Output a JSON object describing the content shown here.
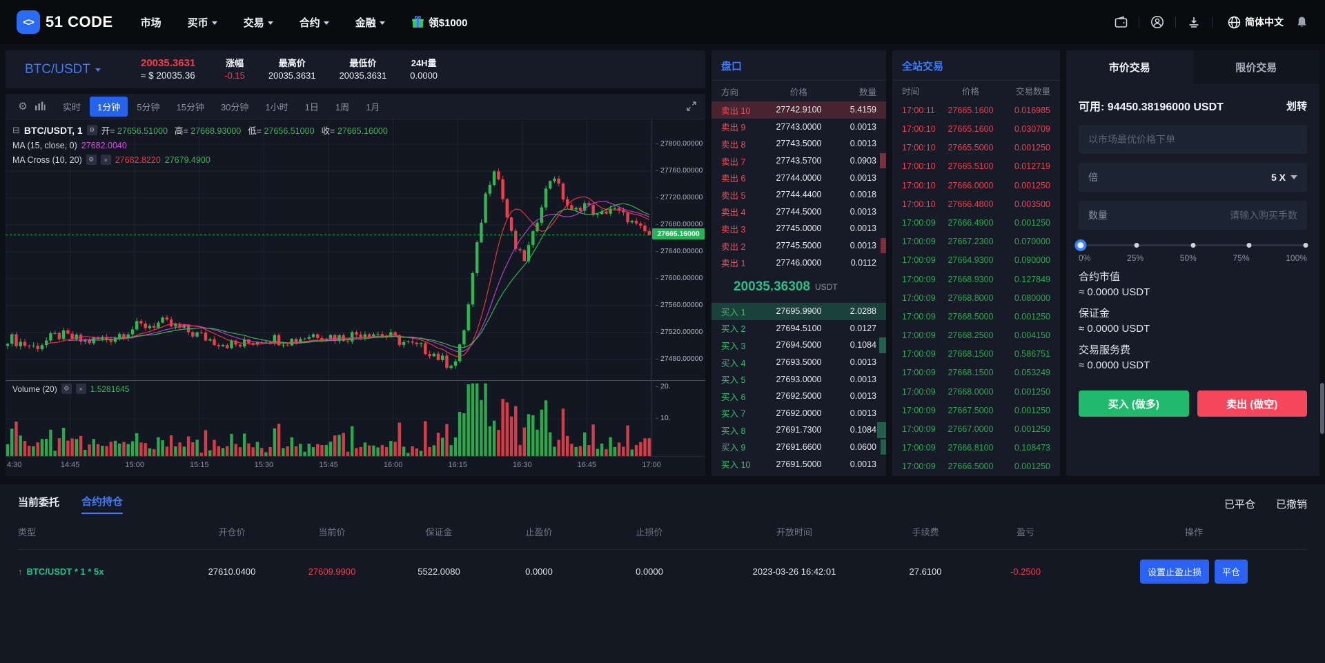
{
  "nav": {
    "brand": "51 CODE",
    "items": [
      {
        "label": "市场",
        "caret": false
      },
      {
        "label": "买币",
        "caret": true
      },
      {
        "label": "交易",
        "caret": true
      },
      {
        "label": "合约",
        "caret": true
      },
      {
        "label": "金融",
        "caret": true
      }
    ],
    "promo": "领$1000",
    "language": "简体中文"
  },
  "ticker": {
    "pair": "BTC/USDT",
    "last_price": "20035.3631",
    "usd_price": "≈ $ 20035.36",
    "stats": [
      {
        "label": "涨幅",
        "value": "-0.15",
        "red": true
      },
      {
        "label": "最高价",
        "value": "20035.3631",
        "red": false
      },
      {
        "label": "最低价",
        "value": "20035.3631",
        "red": false
      },
      {
        "label": "24H量",
        "value": "0.0000",
        "red": false
      }
    ]
  },
  "toolbar": {
    "timeframes": [
      "实时",
      "1分钟",
      "5分钟",
      "15分钟",
      "30分钟",
      "1小时",
      "1日",
      "1周",
      "1月"
    ],
    "active": "1分钟"
  },
  "chart": {
    "legend_title": "BTC/USDT, 1",
    "ohlc": [
      {
        "label": "开=",
        "value": "27656.51000"
      },
      {
        "label": "高=",
        "value": "27668.93000"
      },
      {
        "label": "低=",
        "value": "27656.51000"
      },
      {
        "label": "收=",
        "value": "27665.16000"
      }
    ],
    "ma1_label": "MA (15, close, 0)",
    "ma1_value": "27682.0040",
    "ma2_label": "MA Cross (10, 20)",
    "ma2_value_fast": "27682.8220",
    "ma2_value_slow": "27679.4900",
    "volume_label": "Volume (20)",
    "volume_value": "1.5281645",
    "price_tag": "27665.16000",
    "current_price": 27665.16,
    "y_ticks": [
      "27800.00000",
      "27760.00000",
      "27720.00000",
      "27680.00000",
      "27640.00000",
      "27600.00000",
      "27560.00000",
      "27520.00000",
      "27480.00000"
    ],
    "y_tick_values": [
      27800,
      27760,
      27720,
      27680,
      27640,
      27600,
      27560,
      27520,
      27480
    ],
    "vol_ticks": [
      "20.",
      "10."
    ],
    "x_ticks": [
      "4:30",
      "14:45",
      "15:00",
      "15:15",
      "15:30",
      "15:45",
      "16:00",
      "16:15",
      "16:30",
      "16:45",
      "17:00"
    ],
    "price_path": [
      [
        0.0,
        27512
      ],
      [
        0.04,
        27498
      ],
      [
        0.08,
        27516
      ],
      [
        0.12,
        27506
      ],
      [
        0.16,
        27512
      ],
      [
        0.2,
        27528
      ],
      [
        0.24,
        27534
      ],
      [
        0.28,
        27522
      ],
      [
        0.32,
        27508
      ],
      [
        0.36,
        27500
      ],
      [
        0.4,
        27512
      ],
      [
        0.44,
        27508
      ],
      [
        0.48,
        27518
      ],
      [
        0.52,
        27512
      ],
      [
        0.56,
        27522
      ],
      [
        0.6,
        27512
      ],
      [
        0.63,
        27500
      ],
      [
        0.66,
        27492
      ],
      [
        0.685,
        27472
      ],
      [
        0.7,
        27478
      ],
      [
        0.715,
        27540
      ],
      [
        0.73,
        27640
      ],
      [
        0.745,
        27725
      ],
      [
        0.76,
        27770
      ],
      [
        0.775,
        27705
      ],
      [
        0.79,
        27648
      ],
      [
        0.805,
        27628
      ],
      [
        0.82,
        27668
      ],
      [
        0.835,
        27722
      ],
      [
        0.85,
        27758
      ],
      [
        0.865,
        27722
      ],
      [
        0.88,
        27698
      ],
      [
        0.9,
        27712
      ],
      [
        0.92,
        27692
      ],
      [
        0.94,
        27705
      ],
      [
        0.96,
        27694
      ],
      [
        0.98,
        27678
      ],
      [
        1.0,
        27665.16
      ]
    ],
    "price_max": 27837,
    "price_min": 27449
  },
  "orderbook": {
    "title": "盘口",
    "headers": [
      "方向",
      "价格",
      "数量"
    ],
    "sell_prefix": "卖出",
    "buy_prefix": "买入",
    "asks": [
      {
        "n": "10",
        "price": "27742.9100",
        "qty": "5.4159",
        "depth": 0,
        "hl": true
      },
      {
        "n": "9",
        "price": "27743.0000",
        "qty": "0.0013",
        "depth": 0,
        "hl": false
      },
      {
        "n": "8",
        "price": "27743.5000",
        "qty": "0.0013",
        "depth": 0,
        "hl": false
      },
      {
        "n": "7",
        "price": "27743.5700",
        "qty": "0.0903",
        "depth": 0.035,
        "hl": false
      },
      {
        "n": "6",
        "price": "27744.0000",
        "qty": "0.0013",
        "depth": 0,
        "hl": false
      },
      {
        "n": "5",
        "price": "27744.4400",
        "qty": "0.0018",
        "depth": 0,
        "hl": false
      },
      {
        "n": "4",
        "price": "27744.5000",
        "qty": "0.0013",
        "depth": 0,
        "hl": false
      },
      {
        "n": "3",
        "price": "27745.0000",
        "qty": "0.0013",
        "depth": 0,
        "hl": false
      },
      {
        "n": "2",
        "price": "27745.5000",
        "qty": "0.0013",
        "depth": 0.03,
        "hl": false
      },
      {
        "n": "1",
        "price": "27746.0000",
        "qty": "0.0112",
        "depth": 0,
        "hl": false
      }
    ],
    "mid_price": "20035.36308",
    "mid_unit": "USDT",
    "bids": [
      {
        "n": "1",
        "price": "27695.9900",
        "qty": "2.0288",
        "depth": 0,
        "hl": true
      },
      {
        "n": "2",
        "price": "27694.5100",
        "qty": "0.0127",
        "depth": 0,
        "hl": false
      },
      {
        "n": "3",
        "price": "27694.5000",
        "qty": "0.1084",
        "depth": 0.04,
        "hl": false
      },
      {
        "n": "4",
        "price": "27693.5000",
        "qty": "0.0013",
        "depth": 0,
        "hl": false
      },
      {
        "n": "5",
        "price": "27693.0000",
        "qty": "0.0013",
        "depth": 0,
        "hl": false
      },
      {
        "n": "6",
        "price": "27692.5000",
        "qty": "0.0013",
        "depth": 0,
        "hl": false
      },
      {
        "n": "7",
        "price": "27692.0000",
        "qty": "0.0013",
        "depth": 0,
        "hl": false
      },
      {
        "n": "8",
        "price": "27691.7300",
        "qty": "0.1084",
        "depth": 0.05,
        "hl": false
      },
      {
        "n": "9",
        "price": "27691.6600",
        "qty": "0.0600",
        "depth": 0.03,
        "hl": false
      },
      {
        "n": "10",
        "price": "27691.5000",
        "qty": "0.0013",
        "depth": 0,
        "hl": false
      }
    ]
  },
  "trades": {
    "title": "全站交易",
    "headers": [
      "时间",
      "价格",
      "交易数量"
    ],
    "rows": [
      {
        "time": "17:00:11",
        "price": "27665.1600",
        "qty": "0.016985",
        "side": "sell"
      },
      {
        "time": "17:00:10",
        "price": "27665.1600",
        "qty": "0.030709",
        "side": "sell"
      },
      {
        "time": "17:00:10",
        "price": "27665.5000",
        "qty": "0.001250",
        "side": "sell"
      },
      {
        "time": "17:00:10",
        "price": "27665.5100",
        "qty": "0.012719",
        "side": "sell"
      },
      {
        "time": "17:00:10",
        "price": "27666.0000",
        "qty": "0.001250",
        "side": "sell"
      },
      {
        "time": "17:00:10",
        "price": "27666.4800",
        "qty": "0.003500",
        "side": "sell"
      },
      {
        "time": "17:00:09",
        "price": "27666.4900",
        "qty": "0.001250",
        "side": "buy"
      },
      {
        "time": "17:00:09",
        "price": "27667.2300",
        "qty": "0.070000",
        "side": "buy"
      },
      {
        "time": "17:00:09",
        "price": "27664.9300",
        "qty": "0.090000",
        "side": "buy"
      },
      {
        "time": "17:00:09",
        "price": "27668.9300",
        "qty": "0.127849",
        "side": "buy"
      },
      {
        "time": "17:00:09",
        "price": "27668.8000",
        "qty": "0.080000",
        "side": "buy"
      },
      {
        "time": "17:00:09",
        "price": "27668.5000",
        "qty": "0.001250",
        "side": "buy"
      },
      {
        "time": "17:00:09",
        "price": "27668.2500",
        "qty": "0.004150",
        "side": "buy"
      },
      {
        "time": "17:00:09",
        "price": "27668.1500",
        "qty": "0.586751",
        "side": "buy"
      },
      {
        "time": "17:00:09",
        "price": "27668.1500",
        "qty": "0.053249",
        "side": "buy"
      },
      {
        "time": "17:00:09",
        "price": "27668.0000",
        "qty": "0.001250",
        "side": "buy"
      },
      {
        "time": "17:00:09",
        "price": "27667.5000",
        "qty": "0.001250",
        "side": "buy"
      },
      {
        "time": "17:00:09",
        "price": "27667.0000",
        "qty": "0.001250",
        "side": "buy"
      },
      {
        "time": "17:00:09",
        "price": "27666.8100",
        "qty": "0.108473",
        "side": "buy"
      },
      {
        "time": "17:00:09",
        "price": "27666.5000",
        "qty": "0.001250",
        "side": "buy"
      }
    ]
  },
  "trade_panel": {
    "tabs": [
      "市价交易",
      "限价交易"
    ],
    "active_tab": "市价交易",
    "available_label": "可用:",
    "available_value": "94450.38196000 USDT",
    "transfer_label": "划转",
    "price_placeholder": "以市场最优价格下单",
    "leverage_label": "倍",
    "leverage_value": "5 X",
    "amount_label": "数量",
    "amount_placeholder": "请输入购买手数",
    "slider_labels": [
      "0%",
      "25%",
      "50%",
      "75%",
      "100%"
    ],
    "summary": [
      {
        "label": "合约市值",
        "value": "≈ 0.0000 USDT"
      },
      {
        "label": "保证金",
        "value": "≈ 0.0000 USDT"
      },
      {
        "label": "交易服务费",
        "value": "≈ 0.0000 USDT"
      }
    ],
    "buy_button": "买入 (做多)",
    "sell_button": "卖出 (做空)"
  },
  "positions": {
    "tabs": [
      "当前委托",
      "合约持仓"
    ],
    "active_tab": "合约持仓",
    "right_links": [
      "已平仓",
      "已撤销"
    ],
    "headers": [
      "类型",
      "开仓价",
      "当前价",
      "保证金",
      "止盈价",
      "止损价",
      "开放时间",
      "手续费",
      "盈亏",
      "操作"
    ],
    "row": {
      "type": "BTC/USDT * 1 * 5x",
      "open_price": "27610.0400",
      "current_price": "27609.9900",
      "margin": "5522.0080",
      "take_profit": "0.0000",
      "stop_loss": "0.0000",
      "open_time": "2023-03-26 16:42:01",
      "fee": "27.6100",
      "pnl": "-0.2500",
      "actions": [
        "设置止盈止损",
        "平仓"
      ]
    }
  },
  "colors": {
    "up": "#2fb850",
    "down": "#e8414d",
    "ma_fast": "#f23645",
    "ma_slow": "#3bb650",
    "ma_mid": "#c13fd4",
    "accent_blue": "#3e7bfd",
    "tag_green": "#26b358"
  }
}
